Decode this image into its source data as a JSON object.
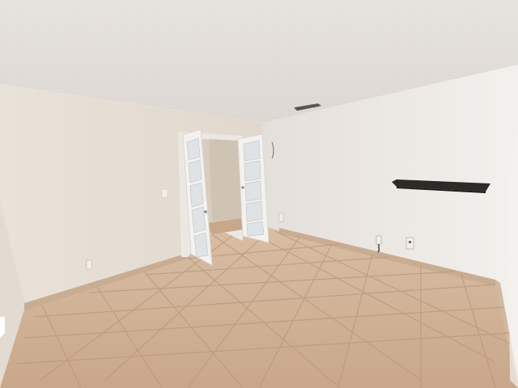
{
  "scene": {
    "kind": "photo",
    "subject": "empty room",
    "colors": {
      "ceiling": "#eae6e2",
      "ceiling_shadow": "#ddd8d3",
      "wall_left": "#e6dfd6",
      "wall_right": "#ece8e4",
      "wall_back": "#e5ddd3",
      "floor_tile": "#d2b49a",
      "floor_tile_dark": "#c7a68a",
      "grout": "#b8977b",
      "baseboard": "#c9ad92",
      "door": "#f4f2ef",
      "door_frame": "#ebe8e4",
      "glass": "#dfe3e6",
      "shelf": "#2e2a27",
      "hallway": "#d8cdbf"
    }
  }
}
